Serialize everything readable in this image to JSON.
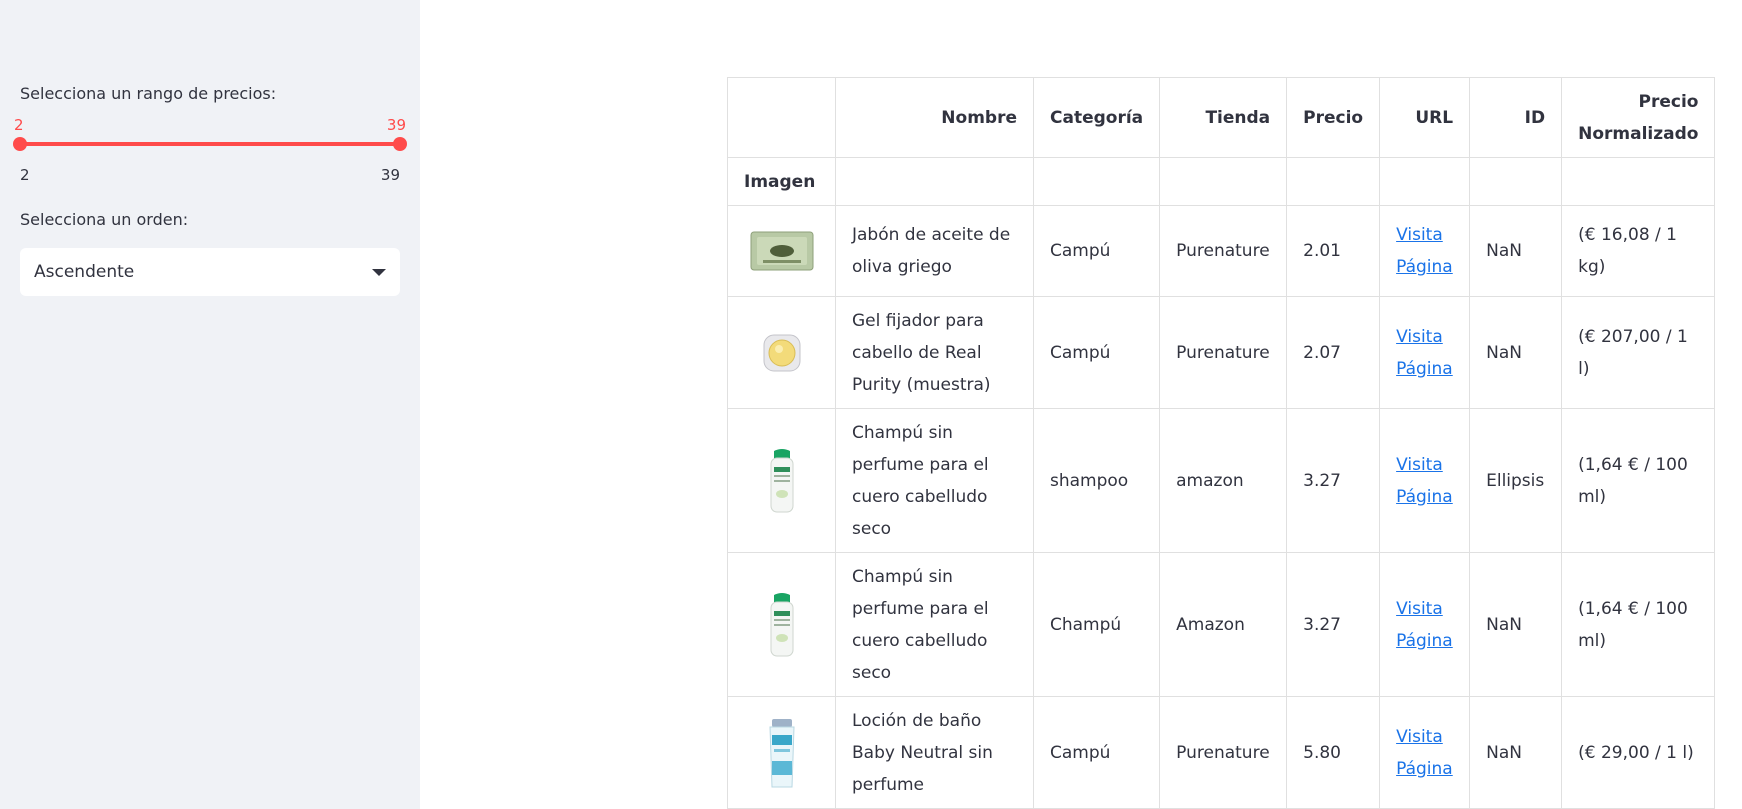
{
  "sidebar": {
    "price_label": "Selecciona un rango de precios:",
    "price_range": {
      "min": 2,
      "max": 39,
      "low_label": "2",
      "high_label": "39",
      "tick_min": "2",
      "tick_max": "39"
    },
    "order_label": "Selecciona un orden:",
    "order_value": "Ascendente"
  },
  "table": {
    "index_header": "Imagen",
    "columns": [
      "Nombre",
      "Categoría",
      "Tienda",
      "Precio",
      "URL",
      "ID",
      "Precio Normalizado"
    ],
    "rows": [
      {
        "image_icon": "soap-bar-icon",
        "nombre": "Jabón de aceite de oliva griego",
        "categoria": "Campú",
        "tienda": "Purenature",
        "precio": "2.01",
        "url": "Visita Página",
        "id": "NaN",
        "precio_normalizado": "(€ 16,08 / 1 kg)"
      },
      {
        "image_icon": "gel-jar-icon",
        "nombre": "Gel fijador para cabello de Real Purity (muestra)",
        "categoria": "Campú",
        "tienda": "Purenature",
        "precio": "2.07",
        "url": "Visita Página",
        "id": "NaN",
        "precio_normalizado": "(€ 207,00 / 1 l)"
      },
      {
        "image_icon": "shampoo-bottle-icon",
        "nombre": "Champú sin perfume para el cuero cabelludo seco",
        "categoria": "shampoo",
        "tienda": "amazon",
        "precio": "3.27",
        "url": "Visita Página",
        "id": "Ellipsis",
        "precio_normalizado": "(1,64 € / 100 ml)"
      },
      {
        "image_icon": "shampoo-bottle-icon",
        "nombre": "Champú sin perfume para el cuero cabelludo seco",
        "categoria": "Champú",
        "tienda": "Amazon",
        "precio": "3.27",
        "url": "Visita Página",
        "id": "NaN",
        "precio_normalizado": "(1,64 € / 100 ml)"
      },
      {
        "image_icon": "lotion-tube-icon",
        "nombre": "Loción de baño Baby Neutral sin perfume",
        "categoria": "Campú",
        "tienda": "Purenature",
        "precio": "5.80",
        "url": "Visita Página",
        "id": "NaN",
        "precio_normalizado": "(€ 29,00 / 1 l)"
      }
    ]
  },
  "colors": {
    "sidebar_bg": "#f0f2f6",
    "accent": "#ff4b4b",
    "link": "#1a73e8",
    "text": "#31333f"
  }
}
